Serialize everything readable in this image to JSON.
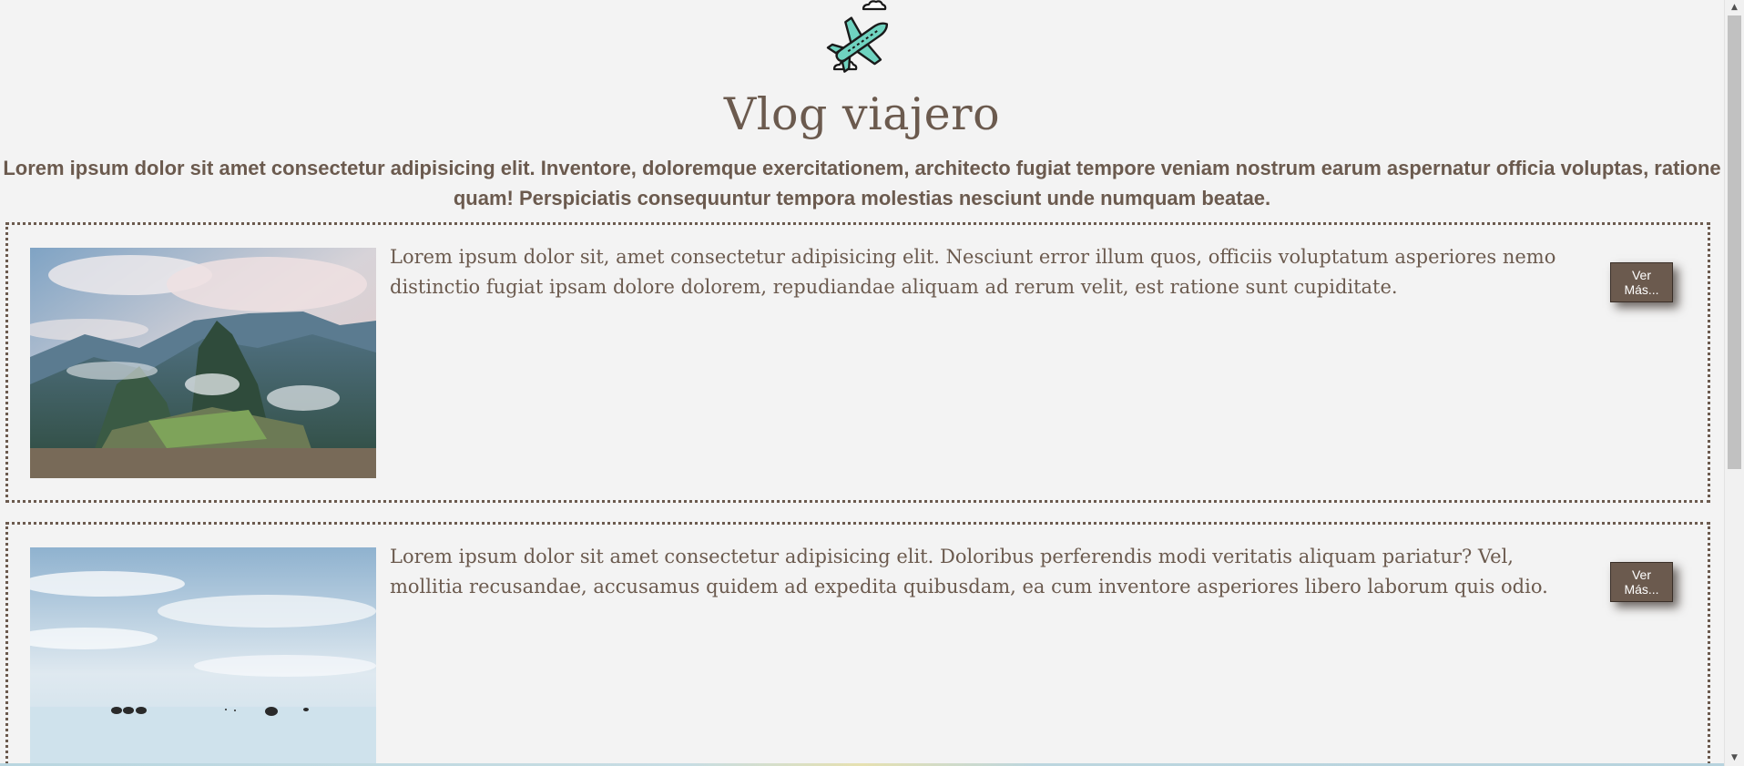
{
  "header": {
    "logo_icon": "airplane-icon",
    "title": "Vlog viajero",
    "intro": "Lorem ipsum dolor sit amet consectetur adipisicing elit. Inventore, doloremque exercitationem, architecto fugiat tempore veniam nostrum earum aspernatur officia voluptas, ratione quam! Perspiciatis consequuntur tempora molestias nesciunt unde numquam beatae."
  },
  "posts": [
    {
      "image_icon": "mountain-ruins-photo",
      "text": "Lorem ipsum dolor sit, amet consectetur adipisicing elit. Nesciunt error illum quos, officiis voluptatum asperiores nemo distinctio fugiat ipsam dolore dolorem, repudiandae aliquam ad rerum velit, est ratione sunt cupiditate.",
      "button_label": "Ver Más..."
    },
    {
      "image_icon": "salt-flat-reflection-photo",
      "text": "Lorem ipsum dolor sit amet consectetur adipisicing elit. Doloribus perferendis modi veritatis aliquam pariatur? Vel, mollitia recusandae, accusamus quidem ad expedita quibusdam, ea cum inventore asperiores libero laborum quis odio.",
      "button_label": "Ver Más..."
    }
  ],
  "colors": {
    "background": "#f3f3f3",
    "text": "#6b5a4e",
    "button": "#6b5a4e",
    "logo_plane": "#6fd3c0"
  }
}
